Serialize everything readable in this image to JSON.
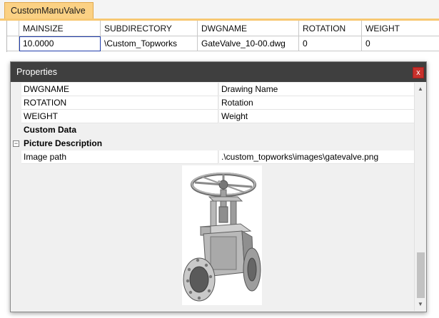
{
  "tab": {
    "label": "CustomManuValve"
  },
  "grid": {
    "columns": [
      "MAINSIZE",
      "SUBDIRECTORY",
      "DWGNAME",
      "ROTATION",
      "WEIGHT"
    ],
    "rows": [
      [
        "10.0000",
        "\\Custom_Topworks",
        "GateValve_10-00.dwg",
        "0",
        "0"
      ]
    ]
  },
  "panel": {
    "title": "Properties",
    "close_glyph": "x",
    "rows": [
      {
        "name": "DWGNAME",
        "value": "Drawing Name"
      },
      {
        "name": "ROTATION",
        "value": "Rotation"
      },
      {
        "name": "WEIGHT",
        "value": "Weight"
      }
    ],
    "categories": {
      "custom_data": "Custom Data",
      "picture_description": "Picture Description"
    },
    "image_path": {
      "name": "Image path",
      "value": ".\\custom_topworks\\images\\gatevalve.png"
    },
    "expander_glyph": "−"
  },
  "icons": {
    "close": "close-icon",
    "collapse": "collapse-icon",
    "scroll_up": "scroll-up-arrow-icon",
    "scroll_down": "scroll-down-arrow-icon",
    "preview": "gate-valve-image"
  },
  "colors": {
    "tab_bg": "#fbd184",
    "panel_title_bg": "#3f3f3f",
    "close_bg": "#c8312c",
    "selection_outline": "#1f3cab"
  }
}
